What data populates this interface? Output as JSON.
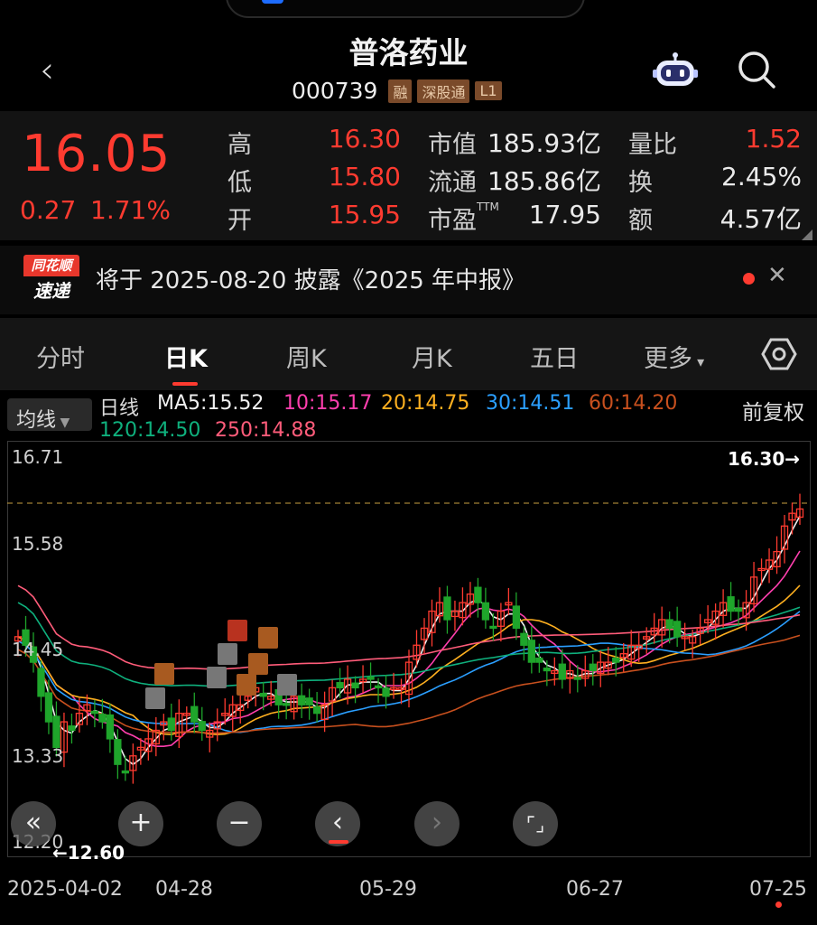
{
  "header": {
    "title": "普洛药业",
    "code": "000739",
    "tags": [
      "融",
      "深股通",
      "L1"
    ]
  },
  "quote": {
    "price": "16.05",
    "change": "0.27",
    "change_pct": "1.71%",
    "high_label": "高",
    "high": "16.30",
    "low_label": "低",
    "low": "15.80",
    "open_label": "开",
    "open": "15.95",
    "mktcap_label": "市值",
    "mktcap": "185.93亿",
    "float_label": "流通",
    "float": "185.86亿",
    "pe_label": "市盈",
    "pe_sup": "TTM",
    "pe": "17.95",
    "vol_ratio_label": "量比",
    "vol_ratio": "1.52",
    "turnover_label": "换",
    "turnover": "2.45%",
    "amount_label": "额",
    "amount": "4.57亿"
  },
  "news": {
    "badge_top": "同花顺",
    "badge_bottom": "速递",
    "text": "将于 2025-08-20 披露《2025 年中报》"
  },
  "tabs": [
    "分时",
    "日K",
    "周K",
    "月K",
    "五日",
    "更多"
  ],
  "active_tab": "日K",
  "ma_bar": {
    "selector": "均线",
    "period": "日线",
    "ma5": "MA5:15.52",
    "ma10": "10:15.17",
    "ma20": "20:14.75",
    "ma30": "30:14.51",
    "ma60": "60:14.20",
    "ma120": "120:14.50",
    "ma250": "250:14.88",
    "adjust": "前复权"
  },
  "chart": {
    "y_labels": [
      "16.71",
      "15.58",
      "14.45",
      "13.33",
      "12.20"
    ],
    "x_labels": [
      "2025-04-02",
      "04-28",
      "05-29",
      "06-27",
      "07-25"
    ],
    "high_marker": "16.30",
    "low_marker": "←12.60",
    "colors": {
      "up": "#ff3b30",
      "down": "#1fa52b",
      "ma5": "#f0f0f0",
      "ma10": "#ff3fae",
      "ma20": "#ffb020",
      "ma30": "#2b9fff",
      "ma60": "#c8501e",
      "ma120": "#0fb07d",
      "ma250": "#ff5c7a"
    }
  }
}
